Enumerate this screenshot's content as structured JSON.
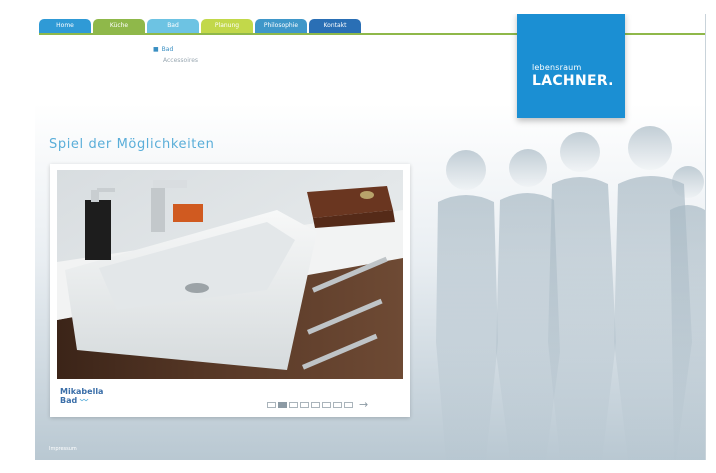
{
  "nav": {
    "tabs": [
      {
        "label": "Home",
        "color": "#2f9ad6"
      },
      {
        "label": "Küche",
        "color": "#8fb84a"
      },
      {
        "label": "Bad",
        "color": "#6dc3e3"
      },
      {
        "label": "Planung",
        "color": "#c2d84a"
      },
      {
        "label": "Philosophie",
        "color": "#3f97c9"
      },
      {
        "label": "Kontakt",
        "color": "#2a6fb5"
      }
    ],
    "line_color": "#8fb84a"
  },
  "subnav": {
    "bullet": "■",
    "active": "Bad",
    "inactive": "Accessoires"
  },
  "logo": {
    "sub": "lebensraum",
    "main": "LACHNER.",
    "color": "#1b8fd3"
  },
  "page_title": "Spiel der Möglichkeiten",
  "gallery": {
    "brand_line1": "Mikabella",
    "brand_line2": "Bad",
    "slides_total": 8,
    "slide_active": 2,
    "next_arrow": "→"
  },
  "footer": {
    "imprint": "Impressum"
  }
}
